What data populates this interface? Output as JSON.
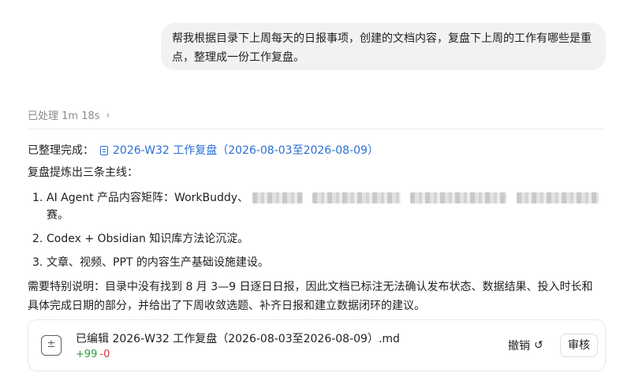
{
  "user_message": {
    "line1": "帮我根据目录下上周每天的日报事项，创建的文档内容，复盘下上周的工作有哪些是重",
    "line2": "点，整理成一份工作复盘。"
  },
  "processed": {
    "label": "已处理 1m 18s",
    "chevron": "›"
  },
  "answer": {
    "done_label": "已整理完成：",
    "doc_link": "2026-W32 工作复盘（2026-08-03至2026-08-09）",
    "intro": "复盘提炼出三条主线：",
    "items": [
      {
        "num": "1.",
        "text_pre": "AI Agent 产品内容矩阵：WorkBuddy、",
        "text_post": "赛。"
      },
      {
        "num": "2.",
        "text": "Codex + Obsidian 知识库方法论沉淀。"
      },
      {
        "num": "3.",
        "text": "文章、视频、PPT 的内容生产基础设施建设。"
      }
    ],
    "note_line1": "需要特别说明：目录中没有找到 8 月 3—9 日逐日日报，因此文档已标注无法确认发布状态、数据结果、投入时长和",
    "note_line2": "具体完成日期的部分，并给出了下周收敛选题、补齐日报和建立数据闭环的建议。"
  },
  "edit_card": {
    "title": "已编辑 2026-W32 工作复盘（2026-08-03至2026-08-09）.md",
    "added": "+99",
    "removed": "-0",
    "undo_label": "撤销",
    "undo_icon": "↺",
    "review_label": "审核",
    "file_icon": "diff-file-icon"
  },
  "colors": {
    "link": "#2a6fd6",
    "added": "#2e9b3e",
    "removed": "#d23b3b"
  }
}
